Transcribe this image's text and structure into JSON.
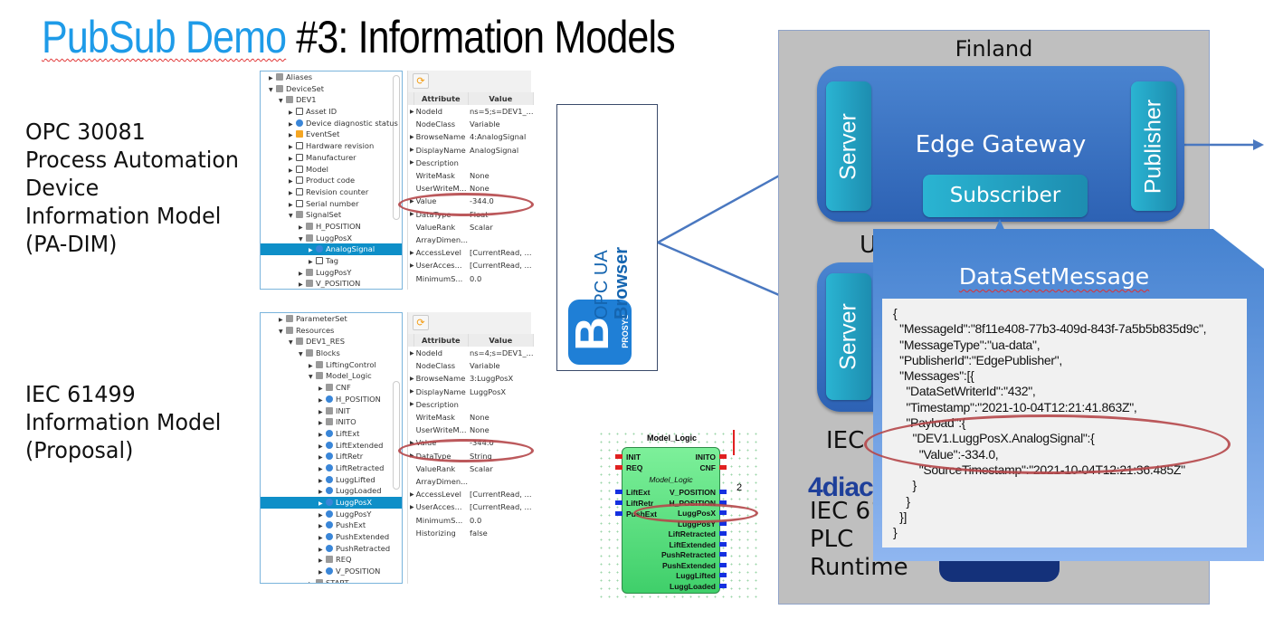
{
  "title": {
    "part1": "PubSub Demo",
    "part2": " #3: Information Models"
  },
  "colors": {
    "title_accent": "#1e9be8",
    "highlight_ellipse": "#b5474a",
    "gateway_blue": "#2d62b4",
    "teal": "#1d8db0"
  },
  "left_labels": {
    "padim": [
      "OPC 30081",
      "Process Automation",
      "Device",
      "Information Model",
      "(PA-DIM)"
    ],
    "iec": [
      "IEC 61499",
      "Information Model",
      "(Proposal)"
    ]
  },
  "browser_top": {
    "tree": [
      {
        "t": "Aliases",
        "d": 1,
        "i": "cube",
        "e": "▶"
      },
      {
        "t": "DeviceSet",
        "d": 1,
        "i": "cube",
        "e": "▼"
      },
      {
        "t": "DEV1",
        "d": 2,
        "i": "cube",
        "e": "▼"
      },
      {
        "t": "Asset ID",
        "d": 3,
        "i": "list",
        "e": "▶"
      },
      {
        "t": "Device diagnostic status",
        "d": 3,
        "i": "var",
        "e": "▶"
      },
      {
        "t": "EventSet",
        "d": 3,
        "i": "folder",
        "e": "▶"
      },
      {
        "t": "Hardware revision",
        "d": 3,
        "i": "list",
        "e": "▶"
      },
      {
        "t": "Manufacturer",
        "d": 3,
        "i": "list",
        "e": "▶"
      },
      {
        "t": "Model",
        "d": 3,
        "i": "list",
        "e": "▶"
      },
      {
        "t": "Product code",
        "d": 3,
        "i": "list",
        "e": "▶"
      },
      {
        "t": "Revision counter",
        "d": 3,
        "i": "list",
        "e": "▶"
      },
      {
        "t": "Serial number",
        "d": 3,
        "i": "list",
        "e": "▶"
      },
      {
        "t": "SignalSet",
        "d": 3,
        "i": "cube",
        "e": "▼"
      },
      {
        "t": "H_POSITION",
        "d": 4,
        "i": "cube",
        "e": "▶"
      },
      {
        "t": "LuggPosX",
        "d": 4,
        "i": "cube",
        "e": "▼"
      },
      {
        "t": "AnalogSignal",
        "d": 5,
        "i": "var",
        "e": "▶",
        "sel": true
      },
      {
        "t": "Tag",
        "d": 5,
        "i": "list",
        "e": "▶"
      },
      {
        "t": "LuggPosY",
        "d": 4,
        "i": "cube",
        "e": "▶"
      },
      {
        "t": "V_POSITION",
        "d": 4,
        "i": "cube",
        "e": "▶"
      }
    ],
    "headers": [
      "Attribute",
      "Value"
    ],
    "rows": [
      [
        "▶",
        "NodeId",
        "ns=5;s=DEV1_..."
      ],
      [
        "",
        "NodeClass",
        "Variable"
      ],
      [
        "▶",
        "BrowseName",
        "4:AnalogSignal"
      ],
      [
        "▶",
        "DisplayName",
        "AnalogSignal"
      ],
      [
        "▶",
        "Description",
        ""
      ],
      [
        "",
        "WriteMask",
        "None"
      ],
      [
        "",
        "UserWriteM...",
        "None"
      ],
      [
        "▶",
        "Value",
        "-344.0"
      ],
      [
        "▶",
        "DataType",
        "Float"
      ],
      [
        "",
        "ValueRank",
        "Scalar"
      ],
      [
        "",
        "ArrayDimen...",
        ""
      ],
      [
        "▶",
        "AccessLevel",
        "[CurrentRead, ..."
      ],
      [
        "▶",
        "UserAcces...",
        "[CurrentRead, ..."
      ],
      [
        "",
        "MinimumS...",
        "0.0"
      ]
    ]
  },
  "browser_bottom": {
    "tree": [
      {
        "t": "ParameterSet",
        "d": 2,
        "i": "cube",
        "e": "▶"
      },
      {
        "t": "Resources",
        "d": 2,
        "i": "cube",
        "e": "▼"
      },
      {
        "t": "DEV1_RES",
        "d": 3,
        "i": "cube",
        "e": "▼"
      },
      {
        "t": "Blocks",
        "d": 4,
        "i": "cube",
        "e": "▼"
      },
      {
        "t": "LiftingControl",
        "d": 5,
        "i": "cube",
        "e": "▶"
      },
      {
        "t": "Model_Logic",
        "d": 5,
        "i": "cube",
        "e": "▼"
      },
      {
        "t": "CNF",
        "d": 6,
        "i": "cube",
        "e": "▶"
      },
      {
        "t": "H_POSITION",
        "d": 6,
        "i": "var",
        "e": "▶"
      },
      {
        "t": "INIT",
        "d": 6,
        "i": "cube",
        "e": "▶"
      },
      {
        "t": "INITO",
        "d": 6,
        "i": "cube",
        "e": "▶"
      },
      {
        "t": "LiftExt",
        "d": 6,
        "i": "var",
        "e": "▶"
      },
      {
        "t": "LiftExtended",
        "d": 6,
        "i": "var",
        "e": "▶"
      },
      {
        "t": "LiftRetr",
        "d": 6,
        "i": "var",
        "e": "▶"
      },
      {
        "t": "LiftRetracted",
        "d": 6,
        "i": "var",
        "e": "▶"
      },
      {
        "t": "LuggLifted",
        "d": 6,
        "i": "var",
        "e": "▶"
      },
      {
        "t": "LuggLoaded",
        "d": 6,
        "i": "var",
        "e": "▶"
      },
      {
        "t": "LuggPosX",
        "d": 6,
        "i": "var",
        "e": "▶",
        "sel": true
      },
      {
        "t": "LuggPosY",
        "d": 6,
        "i": "var",
        "e": "▶"
      },
      {
        "t": "PushExt",
        "d": 6,
        "i": "var",
        "e": "▶"
      },
      {
        "t": "PushExtended",
        "d": 6,
        "i": "var",
        "e": "▶"
      },
      {
        "t": "PushRetracted",
        "d": 6,
        "i": "var",
        "e": "▶"
      },
      {
        "t": "REQ",
        "d": 6,
        "i": "cube",
        "e": "▶"
      },
      {
        "t": "V_POSITION",
        "d": 6,
        "i": "var",
        "e": "▶"
      },
      {
        "t": "START",
        "d": 5,
        "i": "cube",
        "e": "▶"
      }
    ],
    "headers": [
      "Attribute",
      "Value"
    ],
    "rows": [
      [
        "▶",
        "NodeId",
        "ns=4;s=DEV1_..."
      ],
      [
        "",
        "NodeClass",
        "Variable"
      ],
      [
        "▶",
        "BrowseName",
        "3:LuggPosX"
      ],
      [
        "▶",
        "DisplayName",
        "LuggPosX"
      ],
      [
        "▶",
        "Description",
        ""
      ],
      [
        "",
        "WriteMask",
        "None"
      ],
      [
        "",
        "UserWriteM...",
        "None"
      ],
      [
        "▶",
        "Value",
        "-344.0"
      ],
      [
        "▶",
        "DataType",
        "String"
      ],
      [
        "",
        "ValueRank",
        "Scalar"
      ],
      [
        "",
        "ArrayDimen...",
        ""
      ],
      [
        "▶",
        "AccessLevel",
        "[CurrentRead, ..."
      ],
      [
        "▶",
        "UserAcces...",
        "[CurrentRead, ..."
      ],
      [
        "",
        "MinimumS...",
        "0.0"
      ],
      [
        "",
        "Historizing",
        "false"
      ]
    ]
  },
  "opc_browser": {
    "line1": "OPC UA",
    "line2": "Browser",
    "logo_letter": "B",
    "logo_brand": "PROSYS"
  },
  "function_block": {
    "title": "Model_Logic",
    "type": "Model_Logic",
    "event_in": [
      "INIT",
      "REQ"
    ],
    "event_out": [
      "INITO",
      "CNF"
    ],
    "data_in": [
      "LiftExt",
      "LiftRetr",
      "PushExt"
    ],
    "data_out": [
      "V_POSITION",
      "H_POSITION",
      "LuggPosX",
      "LuggPosY",
      "LiftRetracted",
      "LiftExtended",
      "PushRetracted",
      "PushExtended",
      "LuggLifted",
      "LuggLoaded"
    ],
    "side_number": "2"
  },
  "finland": {
    "label": "Finland",
    "gateway": "Edge Gateway",
    "server": "Server",
    "publisher": "Publisher",
    "subscriber": "Subscriber",
    "partial_u": "U",
    "server2": "Server",
    "iec_partial": "IEC 6",
    "diac_logo": "4diac",
    "runtime_lines": [
      "IEC 61",
      "PLC",
      "Runtime"
    ]
  },
  "dataset_message": {
    "title": "DataSetMessage",
    "json": "{\n  \"MessageId\":\"8f11e408-77b3-409d-843f-7a5b5b835d9c\",\n  \"MessageType\":\"ua-data\",\n  \"PublisherId\":\"EdgePublisher\",\n  \"Messages\":[{\n    \"DataSetWriterId\":\"432\",\n    \"Timestamp\":\"2021-10-04T12:21:41.863Z\",\n    \"Payload\":{\n      \"DEV1.LuggPosX.AnalogSignal\":{\n        \"Value\":-334.0,\n        \"SourceTimestamp\":\"2021-10-04T12:21:36.485Z\"\n      }\n    }\n  }]\n}"
  }
}
